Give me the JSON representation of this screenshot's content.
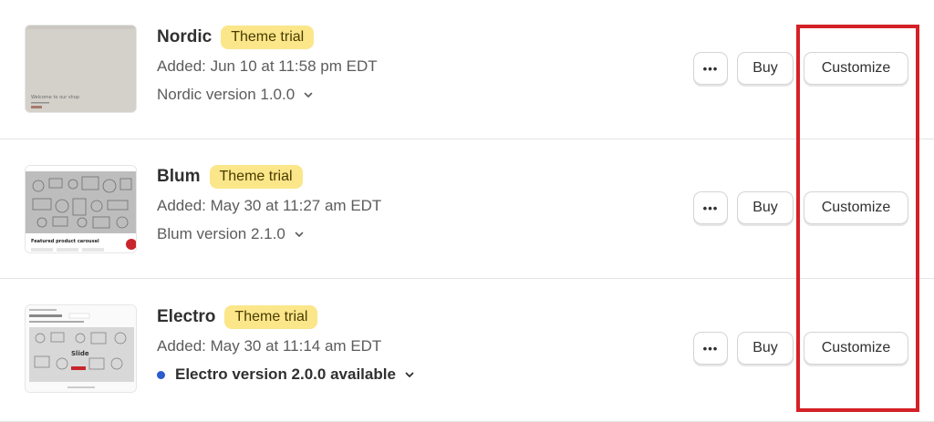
{
  "themes": [
    {
      "name": "Nordic",
      "badge": "Theme trial",
      "added": "Added: Jun 10 at 11:58 pm EDT",
      "version": "Nordic version 1.0.0",
      "update_available": false,
      "thumb_text": "Welcome to our shop"
    },
    {
      "name": "Blum",
      "badge": "Theme trial",
      "added": "Added: May 30 at 11:27 am EDT",
      "version": "Blum version 2.1.0",
      "update_available": false,
      "thumb_text": "Featured product carousel"
    },
    {
      "name": "Electro",
      "badge": "Theme trial",
      "added": "Added: May 30 at 11:14 am EDT",
      "version": "Electro version 2.0.0 available",
      "update_available": true,
      "thumb_text": "Slide"
    }
  ],
  "actions": {
    "more_label": "•••",
    "buy_label": "Buy",
    "customize_label": "Customize"
  },
  "colors": {
    "badge_bg": "#fbe68a",
    "highlight": "#d42127",
    "update_dot": "#2b5ccf"
  }
}
